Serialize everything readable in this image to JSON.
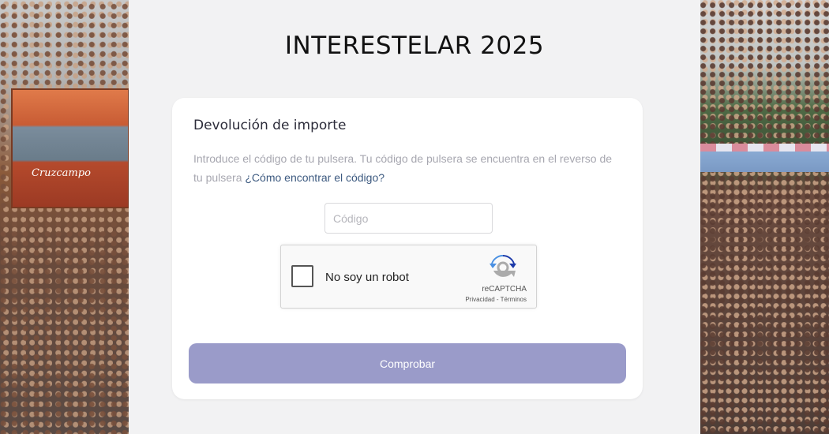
{
  "page": {
    "title": "INTERESTELAR 2025"
  },
  "background": {
    "left_stage_logo": "Cruzcampo"
  },
  "form": {
    "heading": "Devolución de importe",
    "description": "Introduce el código de tu pulsera. Tu código de pulsera se encuentra en el reverso de tu pulsera ",
    "help_link": "¿Cómo encontrar el código?",
    "code_placeholder": "Código",
    "code_value": "",
    "submit_label": "Comprobar"
  },
  "recaptcha": {
    "checkbox_label": "No soy un robot",
    "checked": false,
    "brand": "reCAPTCHA",
    "privacy": "Privacidad",
    "separator": " - ",
    "terms": "Términos"
  },
  "colors": {
    "panel_bg": "#f2f2f3",
    "button_bg": "#9a9bc9",
    "link": "#3d5a80"
  }
}
